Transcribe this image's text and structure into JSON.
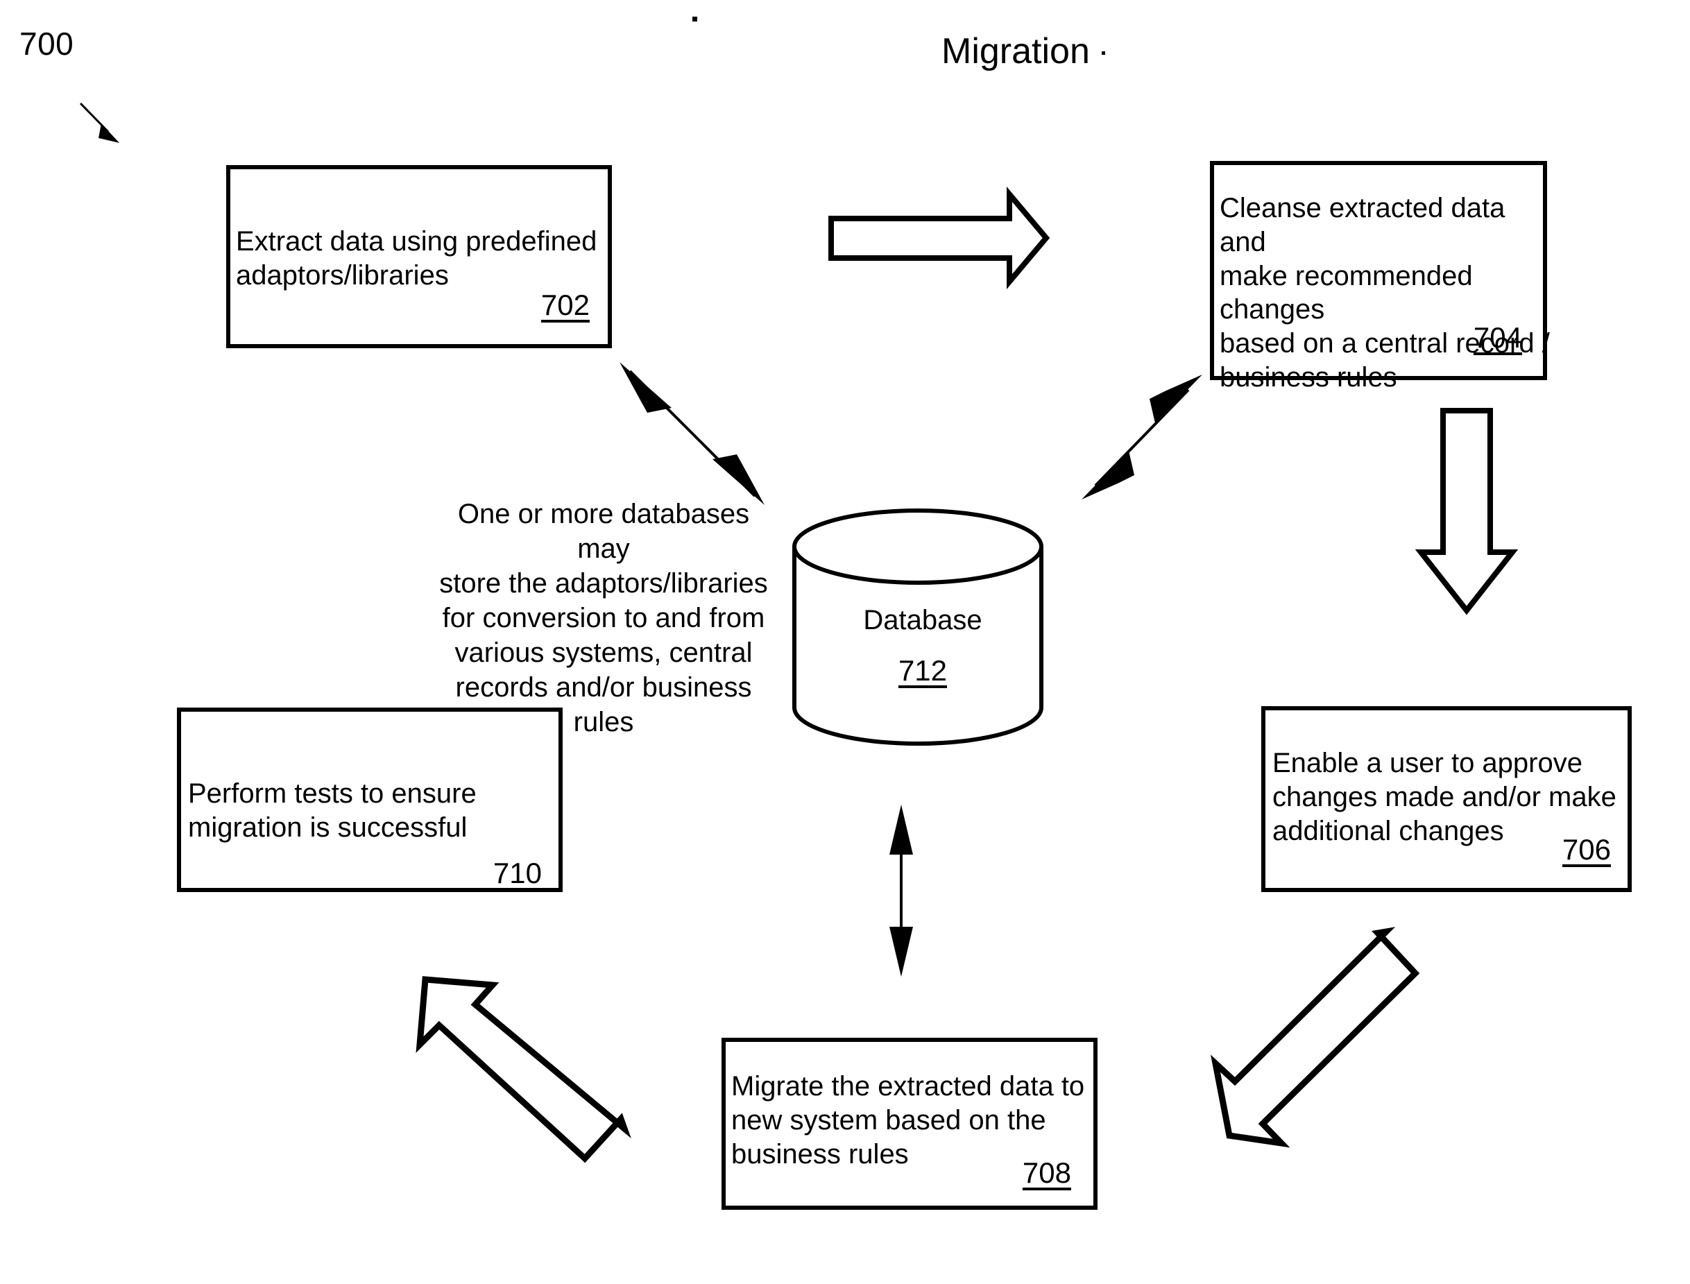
{
  "figure": {
    "number": "700",
    "title": "Migration"
  },
  "nodes": [
    {
      "id": "702",
      "name": "extract-data-box",
      "text": "Extract data using predefined\nadaptors/libraries",
      "ref": "702"
    },
    {
      "id": "704",
      "name": "cleanse-data-box",
      "text": "Cleanse extracted data and\nmake recommended changes\nbased on a central record /\nbusiness rules",
      "ref": "704"
    },
    {
      "id": "706",
      "name": "approve-changes-box",
      "text": "Enable a user to approve\nchanges made and/or make\nadditional changes",
      "ref": "706"
    },
    {
      "id": "708",
      "name": "migrate-data-box",
      "text": "Migrate the extracted data to\nnew system based on the\nbusiness rules",
      "ref": "708"
    },
    {
      "id": "710",
      "name": "perform-tests-box",
      "text": "Perform tests to ensure\nmigration is successful",
      "ref": "710"
    }
  ],
  "database": {
    "label": "Database",
    "ref": "712"
  },
  "center_caption": "One or more databases may\nstore the adaptors/libraries\nfor conversion to and from\nvarious systems, central\nrecords and/or business\nrules",
  "connectors": [
    {
      "name": "block-arrow-extract-to-cleanse",
      "direction": "right"
    },
    {
      "name": "block-arrow-cleanse-to-approve",
      "direction": "down"
    },
    {
      "name": "block-arrow-approve-to-migrate",
      "direction": "down-left"
    },
    {
      "name": "block-arrow-migrate-to-tests",
      "direction": "up-left"
    },
    {
      "name": "double-arrow-database-to-extract",
      "direction": "bidirectional-diagonal"
    },
    {
      "name": "double-arrow-database-to-cleanse",
      "direction": "bidirectional-diagonal"
    },
    {
      "name": "double-arrow-database-to-migrate",
      "direction": "bidirectional-vertical"
    },
    {
      "name": "figure-leader-arrow",
      "direction": "down-right"
    }
  ],
  "colors": {
    "stroke": "#000000",
    "background": "#ffffff"
  }
}
